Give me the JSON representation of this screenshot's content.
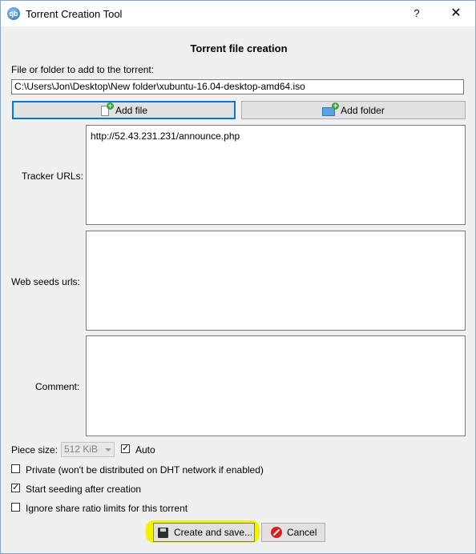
{
  "window": {
    "title": "Torrent Creation Tool",
    "help_label": "?",
    "close_label": "✕"
  },
  "heading": "Torrent file creation",
  "path": {
    "label": "File or folder to add to the torrent:",
    "value": "C:\\Users\\Jon\\Desktop\\New folder\\xubuntu-16.04-desktop-amd64.iso"
  },
  "buttons": {
    "add_file": "Add file",
    "add_folder": "Add folder",
    "create_save": "Create and save...",
    "cancel": "Cancel"
  },
  "tracker": {
    "label": "Tracker URLs:",
    "value": "http://52.43.231.231/announce.php"
  },
  "web_seeds": {
    "label": "Web seeds urls:",
    "value": ""
  },
  "comment": {
    "label": "Comment:",
    "value": ""
  },
  "piece_size": {
    "label": "Piece size:",
    "value": "512 KiB",
    "auto_label": "Auto",
    "auto_checked": true
  },
  "options": {
    "private": {
      "label": "Private (won't be distributed on DHT network if enabled)",
      "checked": false
    },
    "start_seeding": {
      "label": "Start seeding after creation",
      "checked": true
    },
    "ignore_ratio": {
      "label": "Ignore share ratio limits for this torrent",
      "checked": false
    }
  },
  "colors": {
    "highlight": "#f2f200",
    "focus_border": "#0078d7"
  }
}
